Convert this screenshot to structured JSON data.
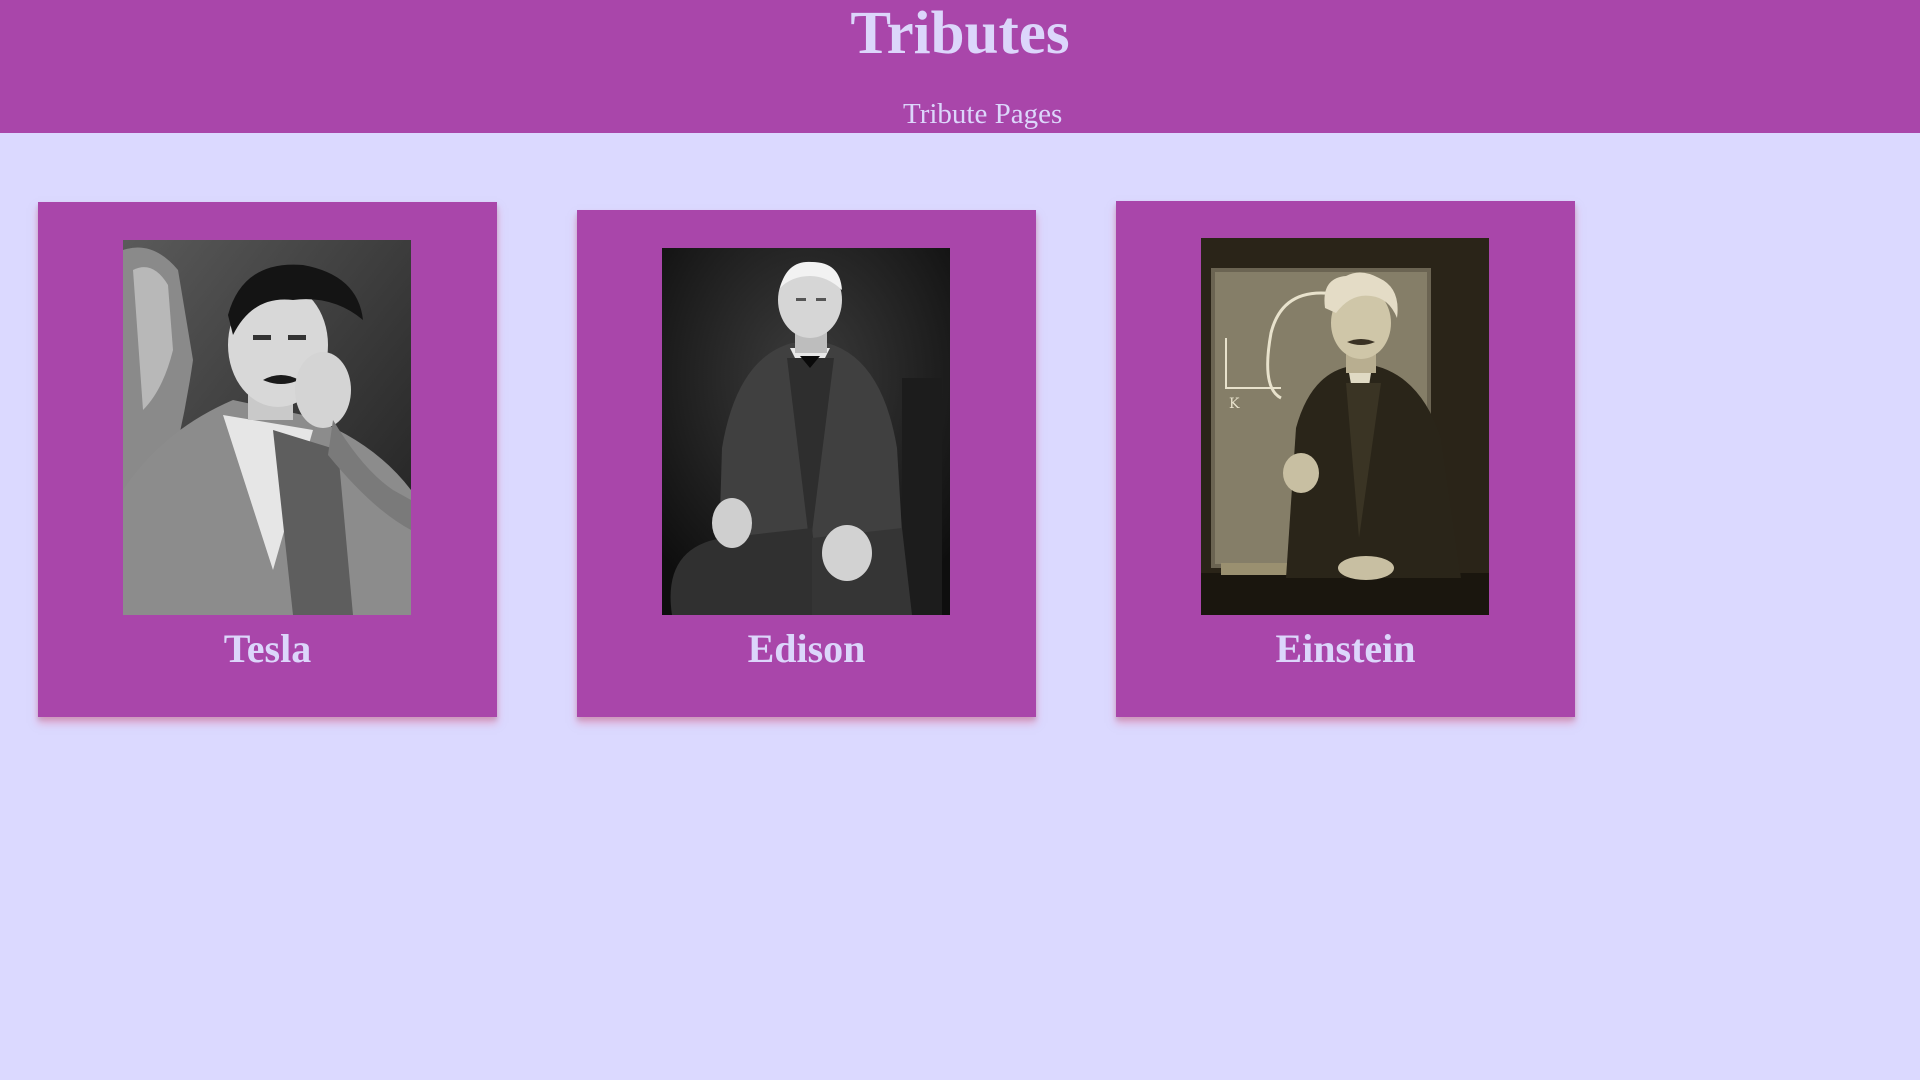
{
  "header": {
    "title": "Tributes",
    "subtitle": "Tribute Pages"
  },
  "colors": {
    "page_background": "#dbd9ff",
    "header_background": "#a946aa",
    "card_background": "#a946aa",
    "text": "#dcd6fb"
  },
  "cards": [
    {
      "name": "Tesla",
      "photo": "portrait-photo-tesla"
    },
    {
      "name": "Edison",
      "photo": "portrait-photo-edison"
    },
    {
      "name": "Einstein",
      "photo": "portrait-photo-einstein"
    }
  ]
}
